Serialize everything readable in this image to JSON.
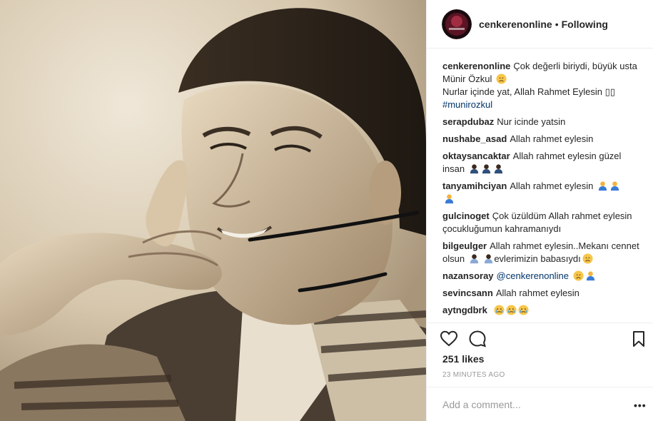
{
  "header": {
    "username": "cenkerenonline",
    "separator": "•",
    "follow_state": "Following"
  },
  "caption": {
    "username": "cenkerenonline",
    "line1": "Çok değerli biriydi, büyük usta Münir Özkul",
    "line2": "Nurlar içinde yat, Allah Rahmet Eylesin",
    "line2_suffix": "▯▯",
    "hashtag": "#munirozkul"
  },
  "comments": [
    {
      "user": "serapdubaz",
      "text": "Nur icinde yatsin",
      "emojis": []
    },
    {
      "user": "nushabe_asad",
      "text": "Allah rahmet eylesin",
      "emojis": []
    },
    {
      "user": "oktaysancaktar",
      "text": "Allah rahmet eylesin güzel insan",
      "emojis": [
        "pray",
        "pray",
        "pray"
      ]
    },
    {
      "user": "tanyamihciyan",
      "text": "Allah rahmet eylesin",
      "emojis": [
        "pray",
        "pray",
        "pray"
      ]
    },
    {
      "user": "gulcinoget",
      "text": "Çok üzüldüm Allah rahmet eylesin çocukluğumun kahramanıydı",
      "emojis": []
    },
    {
      "user": "bilgeulger",
      "text": "Allah rahmet eylesin..Mekanı cennet olsun",
      "text2": "evlerimizin babasıydı",
      "emojis": [
        "pray",
        "pray",
        "sad"
      ]
    },
    {
      "user": "nazansoray",
      "mention": "@cenkerenonline",
      "emojis": [
        "sad",
        "pray"
      ]
    },
    {
      "user": "sevincsann",
      "text": "Allah rahmet eylesin",
      "emojis": []
    },
    {
      "user": "aytngdbrk",
      "text": "",
      "emojis": [
        "cry",
        "cry",
        "cry"
      ]
    }
  ],
  "actions": {
    "like_icon": "heart-icon",
    "comment_icon": "comment-icon",
    "save_icon": "bookmark-icon"
  },
  "likes": "251 likes",
  "timestamp": "23 MINUTES AGO",
  "add_comment": {
    "placeholder": "Add a comment..."
  },
  "more_options": "•••",
  "colors": {
    "link": "#003569",
    "border": "#efefef",
    "muted": "#999999",
    "text": "#262626"
  }
}
